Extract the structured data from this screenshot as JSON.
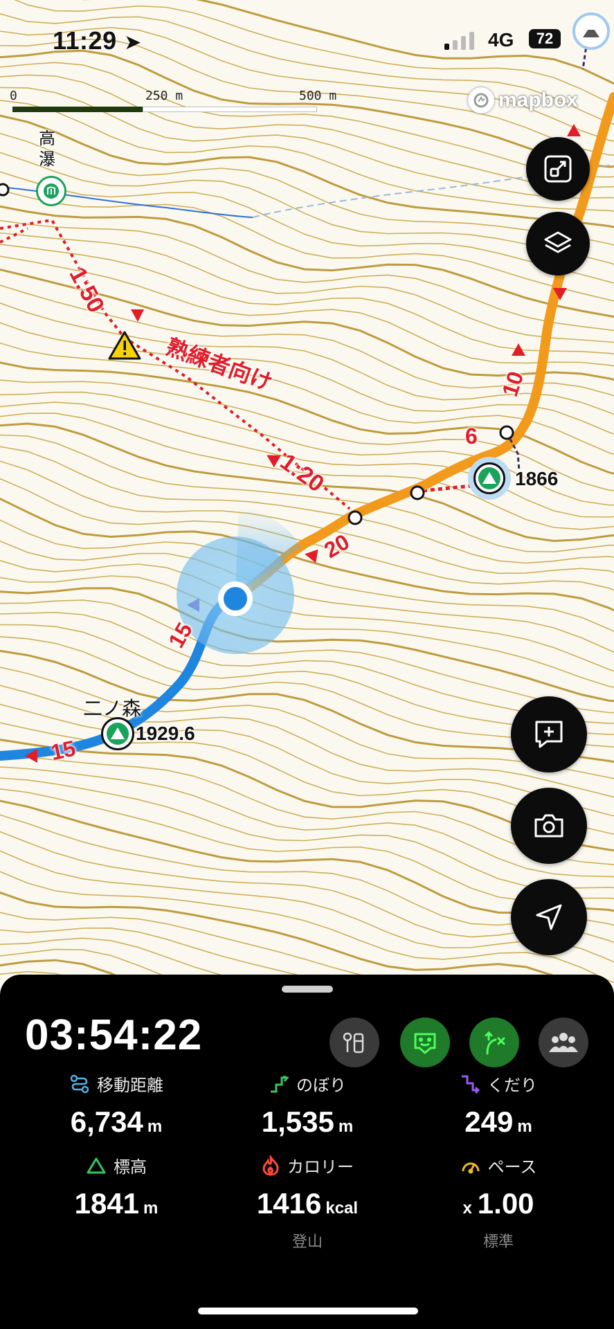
{
  "status_bar": {
    "time": "11:29",
    "network": "4G",
    "battery": "72"
  },
  "map": {
    "scale": {
      "start": "0",
      "mid": "250 m",
      "end": "500 m"
    },
    "attribution": "mapbox",
    "place_label_waterfall": "高\n瀑",
    "summit_1": {
      "name": "二ノ森",
      "elevation": "1929.6"
    },
    "summit_2": {
      "elevation": "1866"
    },
    "warning_text": "熟練者向け",
    "time_labels": {
      "t1": "1:50",
      "t2": "1:20"
    },
    "route_numbers": {
      "n10": "10",
      "n6": "6",
      "n20": "20",
      "n15a": "15",
      "n15b": "15"
    },
    "colors": {
      "contour": "#c9a64a",
      "route_orange": "#f29a1c",
      "track_blue": "#1f86e0",
      "danger_red": "#e11d2a",
      "summit_green": "#1aa35a"
    }
  },
  "map_buttons": [
    "fit-bounds",
    "layers",
    "add-memo",
    "camera",
    "my-location"
  ],
  "panel": {
    "elapsed_time": "03:54:22",
    "tools": [
      "gear",
      "face",
      "route",
      "group"
    ],
    "stats": [
      {
        "label": "移動距離",
        "value": "6,734",
        "unit": "m",
        "color": "#4fb3e8"
      },
      {
        "label": "のぼり",
        "value": "1,535",
        "unit": "m",
        "color": "#3cc45c"
      },
      {
        "label": "くだり",
        "value": "249",
        "unit": "m",
        "color": "#9a5cf0"
      },
      {
        "label": "標高",
        "value": "1841",
        "unit": "m",
        "color": "#3cc45c"
      },
      {
        "label": "カロリー",
        "value": "1416",
        "unit": "kcal",
        "color": "#ff4a3a"
      },
      {
        "label": "ペース",
        "value": "1.00",
        "prefix": "x",
        "color": "#f2b91d"
      }
    ],
    "calorie_mode": "登山",
    "pace_mode": "標準"
  }
}
